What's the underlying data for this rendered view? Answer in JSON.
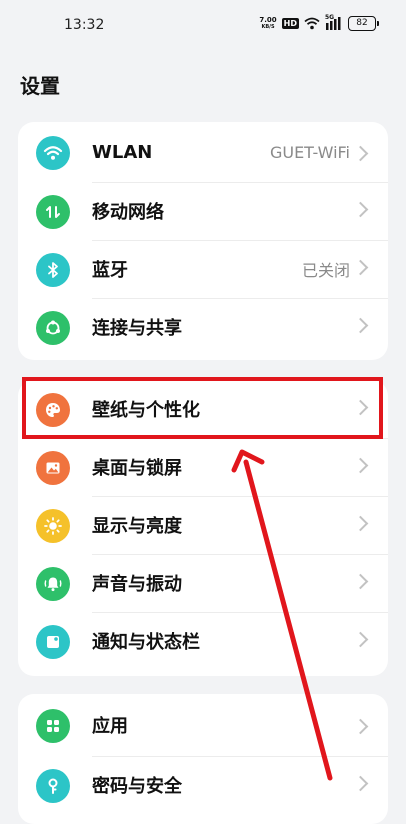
{
  "status_bar": {
    "time": "13:32",
    "net_speed_value": "7.00",
    "net_speed_unit": "KB/S",
    "hd": "HD",
    "network": "5G",
    "battery": "82"
  },
  "page_title": "设置",
  "groups": [
    {
      "items": [
        {
          "label": "WLAN",
          "value": "GUET-WiFi",
          "icon": "wifi-icon",
          "color": "#2cc5c7"
        },
        {
          "label": "移动网络",
          "value": "",
          "icon": "mobile-data-icon",
          "color": "#2ec06a"
        },
        {
          "label": "蓝牙",
          "value": "已关闭",
          "icon": "bluetooth-icon",
          "color": "#2cc5c7"
        },
        {
          "label": "连接与共享",
          "value": "",
          "icon": "share-icon",
          "color": "#2ec06a"
        }
      ]
    },
    {
      "items": [
        {
          "label": "壁纸与个性化",
          "value": "",
          "icon": "palette-icon",
          "color": "#f0733e"
        },
        {
          "label": "桌面与锁屏",
          "value": "",
          "icon": "image-icon",
          "color": "#f0733e"
        },
        {
          "label": "显示与亮度",
          "value": "",
          "icon": "sun-icon",
          "color": "#f5c12a"
        },
        {
          "label": "声音与振动",
          "value": "",
          "icon": "bell-icon",
          "color": "#2ec06a"
        },
        {
          "label": "通知与状态栏",
          "value": "",
          "icon": "notification-icon",
          "color": "#2cc5c7"
        }
      ]
    },
    {
      "items": [
        {
          "label": "应用",
          "value": "",
          "icon": "apps-icon",
          "color": "#2ec06a"
        },
        {
          "label": "密码与安全",
          "value": "",
          "icon": "key-icon",
          "color": "#2cc5c7"
        }
      ]
    }
  ],
  "annotation": {
    "color": "#e1161c"
  }
}
